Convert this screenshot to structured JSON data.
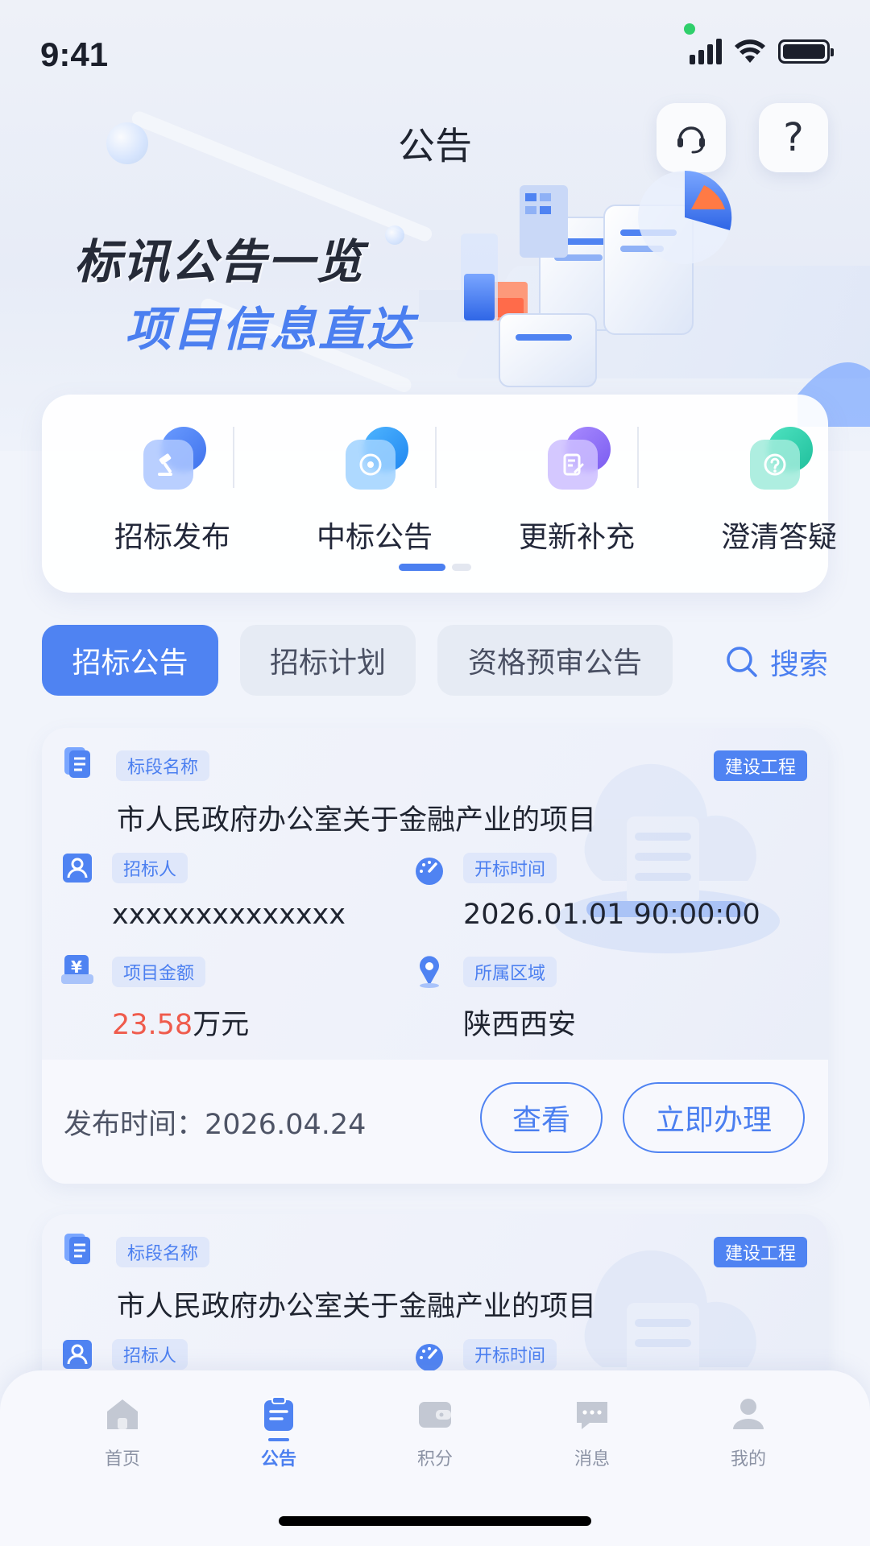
{
  "status_bar": {
    "time": "9:41"
  },
  "header": {
    "title": "公告",
    "support_icon": "headset-icon",
    "help_icon": "question-icon",
    "help_glyph": "?"
  },
  "banner": {
    "line1": "标讯公告一览",
    "line2": "项目信息直达"
  },
  "categories": [
    {
      "label": "招标发布",
      "icon": "gavel-icon",
      "color": "#4f83f2"
    },
    {
      "label": "中标公告",
      "icon": "target-icon",
      "color": "#2f9cf5"
    },
    {
      "label": "更新补充",
      "icon": "edit-doc-icon",
      "color": "#8c68f0"
    },
    {
      "label": "澄清答疑",
      "icon": "question-circle-icon",
      "color": "#27c7a7"
    }
  ],
  "tabs": [
    {
      "label": "招标公告",
      "active": true
    },
    {
      "label": "招标计划",
      "active": false
    },
    {
      "label": "资格预审公告",
      "active": false
    }
  ],
  "search": {
    "label": "搜索"
  },
  "notices": [
    {
      "section_label": "标段名称",
      "type_badge": "建设工程",
      "project_name": "市人民政府办公室关于金融产业的项目",
      "tenderer_label": "招标人",
      "tenderer": "xxxxxxxxxxxxxx",
      "open_time_label": "开标时间",
      "open_time": "2026.01.01 90:00:00",
      "amount_label": "项目金额",
      "amount_value": "23.58",
      "amount_unit": "万元",
      "region_label": "所属区域",
      "region": "陕西西安",
      "publish_time": "发布时间：2026.04.24",
      "view_button": "查看",
      "handle_button": "立即办理"
    },
    {
      "section_label": "标段名称",
      "type_badge": "建设工程",
      "project_name": "市人民政府办公室关于金融产业的项目",
      "tenderer_label": "招标人",
      "open_time_label": "开标时间"
    }
  ],
  "bottom_nav": [
    {
      "label": "首页",
      "icon": "home-icon",
      "active": false
    },
    {
      "label": "公告",
      "icon": "clipboard-icon",
      "active": true
    },
    {
      "label": "积分",
      "icon": "wallet-icon",
      "active": false
    },
    {
      "label": "消息",
      "icon": "message-icon",
      "active": false
    },
    {
      "label": "我的",
      "icon": "user-icon",
      "active": false
    }
  ],
  "colors": {
    "accent": "#4f83f2",
    "amount": "#ef5b4c",
    "background": "#f1f4fb"
  }
}
